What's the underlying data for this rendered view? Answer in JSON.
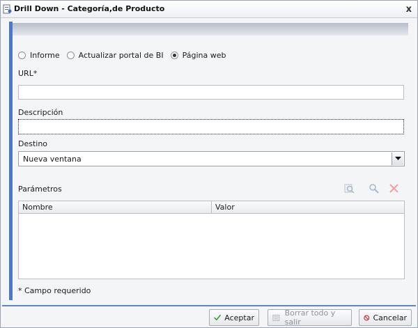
{
  "window": {
    "title": "Drill Down - Categoría,de Producto",
    "close_label": "x"
  },
  "link_type": {
    "options": [
      {
        "label": "Informe",
        "selected": false
      },
      {
        "label": "Actualizar portal de BI",
        "selected": false
      },
      {
        "label": "Página web",
        "selected": true
      }
    ]
  },
  "url": {
    "label": "URL*",
    "value": ""
  },
  "descripcion": {
    "label": "Descripción",
    "value": ""
  },
  "destino": {
    "label": "Destino",
    "value": "Nueva ventana"
  },
  "parametros": {
    "label": "Parámetros",
    "columns": [
      "Nombre",
      "Valor"
    ],
    "rows": []
  },
  "required_note": "* Campo requerido",
  "buttons": {
    "accept": "Aceptar",
    "clear_exit": "Borrar todo y salir",
    "cancel": "Cancelar"
  },
  "colors": {
    "accent_bar": "#4b78c8",
    "accept_check": "#2f9a2f",
    "cancel_icon": "#c62828"
  }
}
